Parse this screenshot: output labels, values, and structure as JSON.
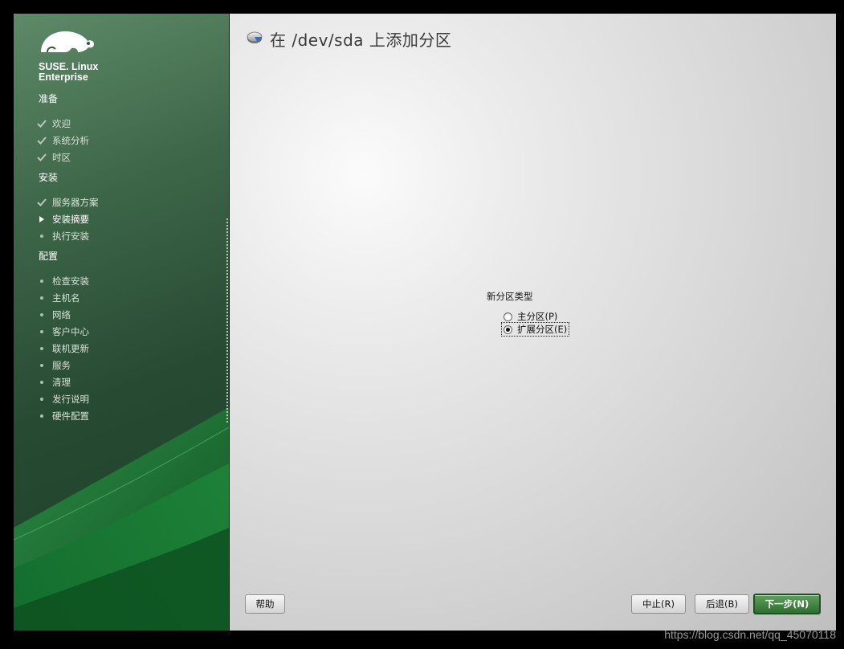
{
  "window": {
    "title": "在 /dev/sda 上添加分区",
    "title_icon": "disk-icon"
  },
  "brand": {
    "line1": "SUSE. Linux",
    "line2": "Enterprise",
    "logo": "chameleon-logo"
  },
  "colors": {
    "sidebar_green": "#2b5a36",
    "primary_button": "#2e6e30",
    "background": "#000000"
  },
  "sidebar": {
    "sections": [
      {
        "label": "准备",
        "steps": [
          {
            "label": "欢迎",
            "status": "done"
          },
          {
            "label": "系统分析",
            "status": "done"
          },
          {
            "label": "时区",
            "status": "done"
          }
        ]
      },
      {
        "label": "安装",
        "steps": [
          {
            "label": "服务器方案",
            "status": "done"
          },
          {
            "label": "安装摘要",
            "status": "current"
          },
          {
            "label": "执行安装",
            "status": "pending"
          }
        ]
      },
      {
        "label": "配置",
        "steps": [
          {
            "label": "检查安装",
            "status": "pending"
          },
          {
            "label": "主机名",
            "status": "pending"
          },
          {
            "label": "网络",
            "status": "pending"
          },
          {
            "label": "客户中心",
            "status": "pending"
          },
          {
            "label": "联机更新",
            "status": "pending"
          },
          {
            "label": "服务",
            "status": "pending"
          },
          {
            "label": "清理",
            "status": "pending"
          },
          {
            "label": "发行说明",
            "status": "pending"
          },
          {
            "label": "硬件配置",
            "status": "pending"
          }
        ]
      }
    ]
  },
  "form": {
    "group_label": "新分区类型",
    "options": [
      {
        "label": "主分区(P)",
        "checked": false
      },
      {
        "label": "扩展分区(E)",
        "checked": true
      }
    ]
  },
  "buttons": {
    "help": "帮助",
    "abort": "中止(R)",
    "back": "后退(B)",
    "next": "下一步(N)"
  },
  "watermark": "https://blog.csdn.net/qq_45070118"
}
